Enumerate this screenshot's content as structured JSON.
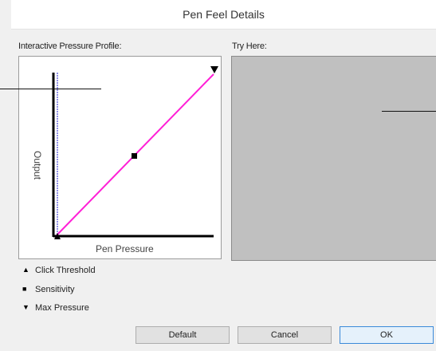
{
  "dialog": {
    "title": "Pen Feel Details"
  },
  "profile": {
    "label": "Interactive Pressure Profile:",
    "x_axis_label": "Pen Pressure",
    "y_axis_label": "Output",
    "curve_color": "#ff1fd6",
    "threshold_line_color": "#2222cc"
  },
  "try_here": {
    "label": "Try Here:",
    "background": "#c0c0c0"
  },
  "legend": [
    {
      "symbol": "▲",
      "icon": "triangle-up-icon",
      "label": "Click Threshold"
    },
    {
      "symbol": "■",
      "icon": "square-icon",
      "label": "Sensitivity"
    },
    {
      "symbol": "▼",
      "icon": "triangle-down-icon",
      "label": "Max Pressure"
    }
  ],
  "buttons": {
    "default": "Default",
    "cancel": "Cancel",
    "ok": "OK"
  }
}
